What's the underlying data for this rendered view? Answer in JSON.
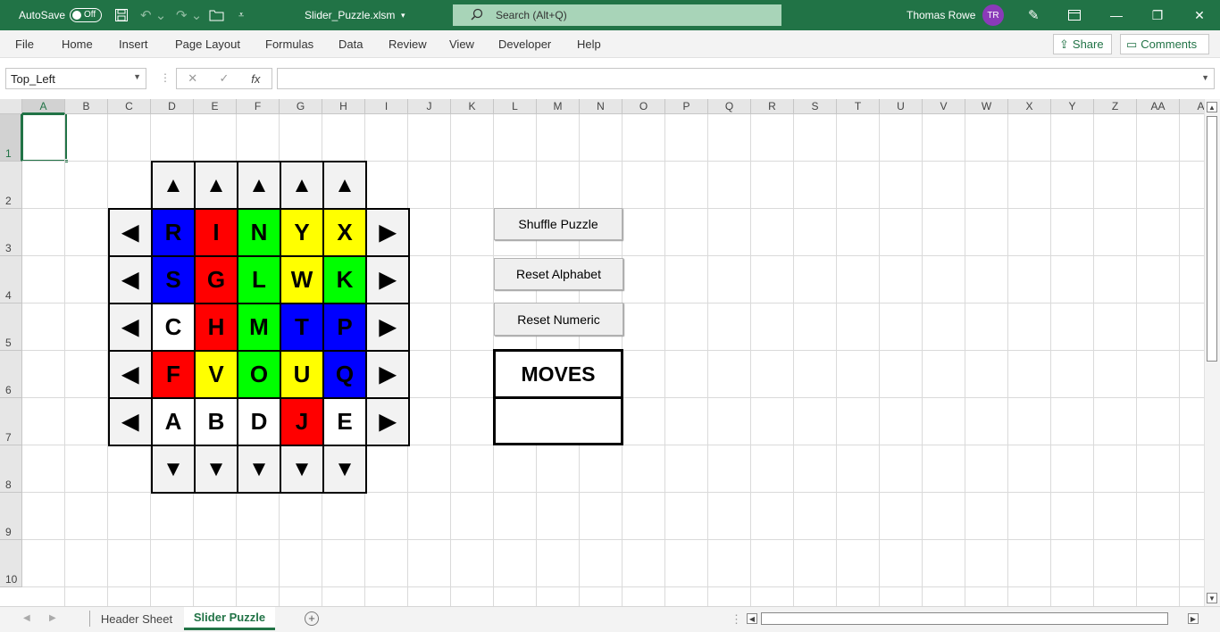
{
  "titlebar": {
    "autosave_label": "AutoSave",
    "autosave_state": "Off",
    "filename": "Slider_Puzzle.xlsm",
    "search_placeholder": "Search (Alt+Q)",
    "user_name": "Thomas Rowe",
    "user_initials": "TR"
  },
  "ribbon": {
    "tabs": [
      "File",
      "Home",
      "Insert",
      "Page Layout",
      "Formulas",
      "Data",
      "Review",
      "View",
      "Developer",
      "Help"
    ],
    "share_label": "Share",
    "comments_label": "Comments"
  },
  "formula_bar": {
    "name_box": "Top_Left",
    "fx_label": "fx",
    "formula": ""
  },
  "columns": [
    "A",
    "B",
    "C",
    "D",
    "E",
    "F",
    "G",
    "H",
    "I",
    "J",
    "K",
    "L",
    "M",
    "N",
    "O",
    "P",
    "Q",
    "R",
    "S",
    "T",
    "U",
    "V",
    "W",
    "X",
    "Y",
    "Z",
    "AA",
    "A"
  ],
  "rows": [
    "1",
    "2",
    "3",
    "4",
    "5",
    "6",
    "7",
    "8",
    "9",
    "10"
  ],
  "puzzle": {
    "up_arrow": "▲",
    "down_arrow": "▼",
    "left_arrow": "◀",
    "right_arrow": "▶",
    "tiles": [
      [
        {
          "letter": "R",
          "color": "blue"
        },
        {
          "letter": "I",
          "color": "red"
        },
        {
          "letter": "N",
          "color": "green"
        },
        {
          "letter": "Y",
          "color": "yellow"
        },
        {
          "letter": "X",
          "color": "yellow"
        }
      ],
      [
        {
          "letter": "S",
          "color": "blue"
        },
        {
          "letter": "G",
          "color": "red"
        },
        {
          "letter": "L",
          "color": "green"
        },
        {
          "letter": "W",
          "color": "yellow"
        },
        {
          "letter": "K",
          "color": "green"
        }
      ],
      [
        {
          "letter": "C",
          "color": "white"
        },
        {
          "letter": "H",
          "color": "red"
        },
        {
          "letter": "M",
          "color": "green"
        },
        {
          "letter": "T",
          "color": "blue"
        },
        {
          "letter": "P",
          "color": "blue"
        }
      ],
      [
        {
          "letter": "F",
          "color": "red"
        },
        {
          "letter": "V",
          "color": "yellow"
        },
        {
          "letter": "O",
          "color": "green"
        },
        {
          "letter": "U",
          "color": "yellow"
        },
        {
          "letter": "Q",
          "color": "blue"
        }
      ],
      [
        {
          "letter": "A",
          "color": "white"
        },
        {
          "letter": "B",
          "color": "white"
        },
        {
          "letter": "D",
          "color": "white"
        },
        {
          "letter": "J",
          "color": "red"
        },
        {
          "letter": "E",
          "color": "white"
        }
      ]
    ]
  },
  "controls": {
    "shuffle_label": "Shuffle Puzzle",
    "reset_alpha_label": "Reset Alphabet",
    "reset_numeric_label": "Reset Numeric",
    "moves_label": "MOVES",
    "moves_value": ""
  },
  "sheets": {
    "tabs": [
      {
        "name": "Header Sheet",
        "active": false
      },
      {
        "name": "Slider Puzzle",
        "active": true
      }
    ]
  },
  "colors": {
    "accent": "#217346",
    "blue": "#0000ff",
    "red": "#ff0000",
    "green": "#00ff00",
    "yellow": "#ffff00",
    "white": "#ffffff"
  }
}
